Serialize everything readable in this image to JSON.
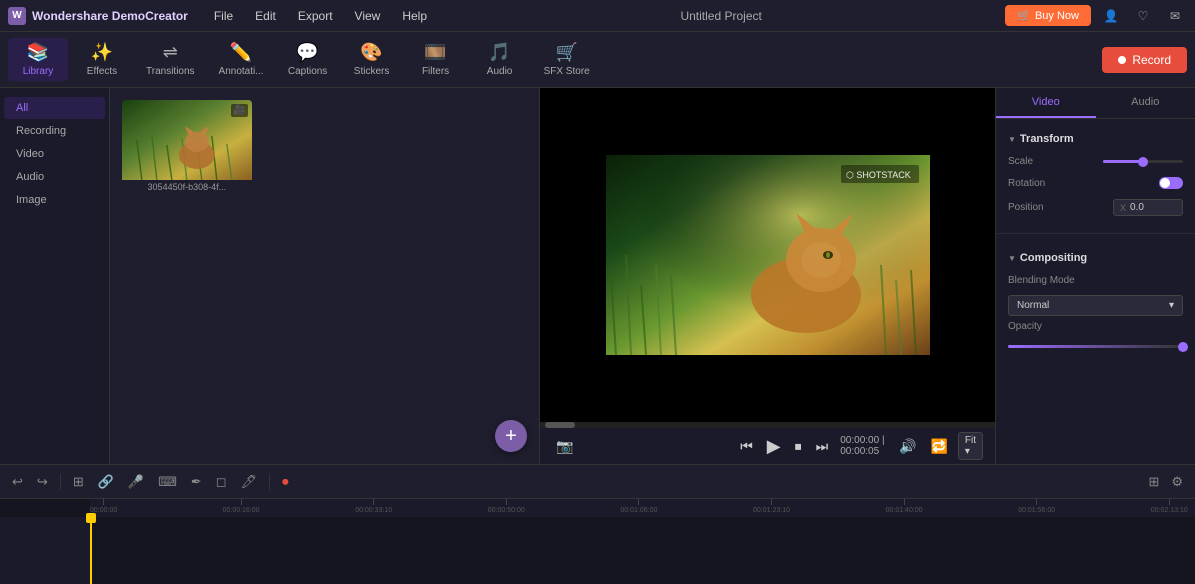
{
  "app": {
    "name": "Wondershare DemoCreator",
    "logo_text": "Wondershare DemoCreator",
    "project_title": "Untitled Project"
  },
  "menu": {
    "items": [
      "File",
      "Edit",
      "Export",
      "View",
      "Help"
    ]
  },
  "top_actions": {
    "buy_now": "Buy Now"
  },
  "toolbar": {
    "items": [
      {
        "id": "library",
        "label": "Library",
        "icon": "📚",
        "active": true
      },
      {
        "id": "effects",
        "label": "Effects",
        "icon": "✨",
        "active": false
      },
      {
        "id": "transitions",
        "label": "Transitions",
        "icon": "🔄",
        "active": false
      },
      {
        "id": "annotations",
        "label": "Annotati...",
        "icon": "✏️",
        "active": false
      },
      {
        "id": "captions",
        "label": "Captions",
        "icon": "💬",
        "active": false
      },
      {
        "id": "stickers",
        "label": "Stickers",
        "icon": "🎨",
        "active": false
      },
      {
        "id": "filters",
        "label": "Filters",
        "icon": "🎞️",
        "active": false
      },
      {
        "id": "audio",
        "label": "Audio",
        "icon": "🎵",
        "active": false
      },
      {
        "id": "sfx_store",
        "label": "SFX Store",
        "icon": "🛒",
        "active": false
      }
    ],
    "record_label": "Record"
  },
  "library": {
    "categories": [
      {
        "id": "all",
        "label": "All",
        "active": true
      },
      {
        "id": "recording",
        "label": "Recording",
        "active": false
      },
      {
        "id": "video",
        "label": "Video",
        "active": false
      },
      {
        "id": "audio",
        "label": "Audio",
        "active": false
      },
      {
        "id": "image",
        "label": "Image",
        "active": false
      }
    ],
    "media_items": [
      {
        "id": "1",
        "filename": "3054450f-b308-4f..."
      }
    ]
  },
  "preview": {
    "time_start": "00:00:00",
    "time_separator": "|",
    "time_end": "00:00:05",
    "fit_option": "Fit",
    "shotstack_label": "SHOTSTACK"
  },
  "right_panel": {
    "tabs": [
      {
        "id": "video",
        "label": "Video",
        "active": true
      },
      {
        "id": "audio",
        "label": "Audio",
        "active": false
      }
    ],
    "transform": {
      "section_label": "Transform",
      "scale_label": "Scale",
      "scale_value": 50,
      "rotation_label": "Rotation",
      "position_label": "Position",
      "position_x_label": "X",
      "position_x_value": "0.0"
    },
    "compositing": {
      "section_label": "Compositing",
      "blending_mode_label": "Blending Mode",
      "blending_mode_value": "Normal",
      "opacity_label": "Opacity"
    }
  },
  "timeline": {
    "ruler_marks": [
      "00:00:00",
      "00:00:16:00",
      "00:00:33:10",
      "00:00:50:00",
      "00:01:06:00",
      "00:01:23:10",
      "00:01:40:00",
      "00:01:56:00",
      "00:02:13:10"
    ],
    "toolbar_buttons": [
      "↩",
      "↪",
      "⊞",
      "🔗",
      "🎤",
      "⌨",
      "✒",
      "◻",
      "🖊",
      "🔴"
    ],
    "playhead_position": 0
  }
}
